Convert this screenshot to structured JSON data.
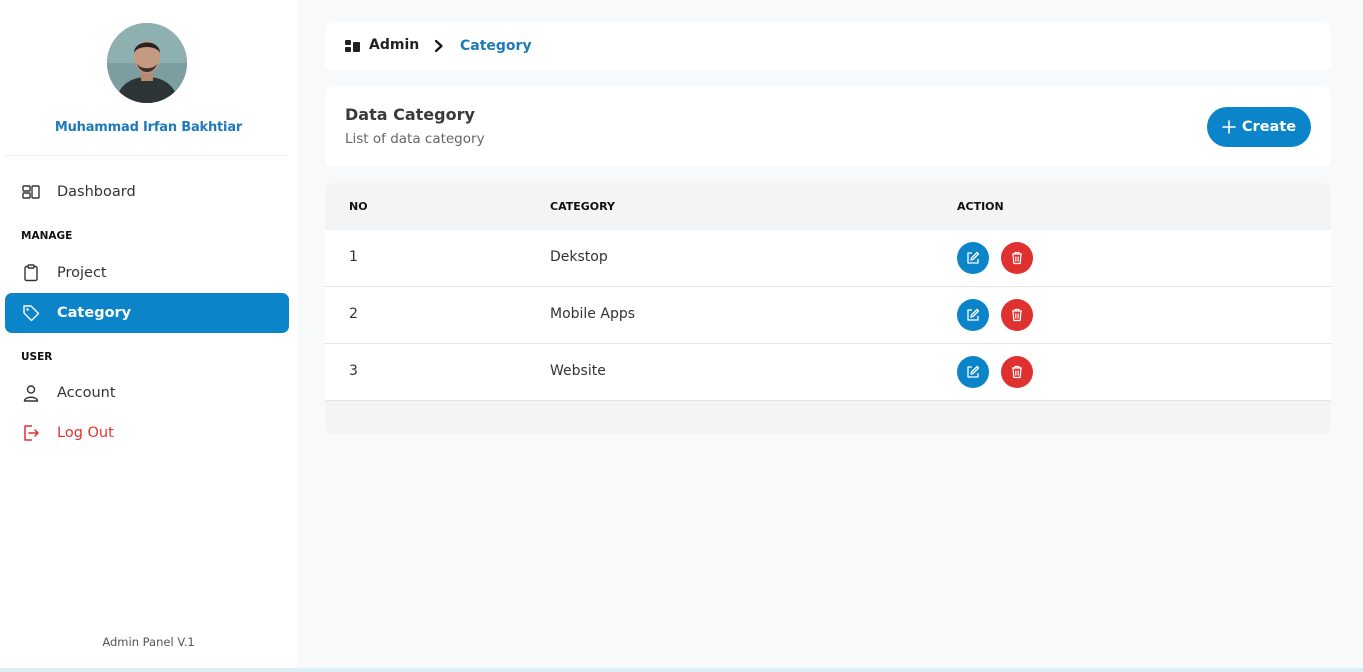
{
  "sidebar": {
    "user_name": "Muhammad Irfan Bakhtiar",
    "nav": {
      "dashboard": "Dashboard",
      "manage_section": "MANAGE",
      "project": "Project",
      "category": "Category",
      "user_section": "USER",
      "account": "Account",
      "logout": "Log Out"
    },
    "footer": "Admin Panel V.1"
  },
  "breadcrumb": {
    "root": "Admin",
    "current": "Category"
  },
  "header": {
    "title": "Data Category",
    "subtitle": "List of data category",
    "create_label": "Create"
  },
  "table": {
    "columns": [
      "NO",
      "CATEGORY",
      "ACTION"
    ],
    "rows": [
      {
        "no": "1",
        "category": "Dekstop"
      },
      {
        "no": "2",
        "category": "Mobile Apps"
      },
      {
        "no": "3",
        "category": "Website"
      }
    ]
  },
  "colors": {
    "accent": "#0b84c9",
    "danger": "#e03131",
    "background": "#f8f9fa"
  },
  "icons": {
    "breadcrumb": "dashboard-grid-icon",
    "separator": "chevron-right-icon",
    "dashboard": "layout-icon",
    "project": "clipboard-icon",
    "category": "tag-icon",
    "account": "user-icon",
    "logout": "logout-icon",
    "create": "plus-icon",
    "edit": "edit-icon",
    "delete": "trash-icon"
  }
}
